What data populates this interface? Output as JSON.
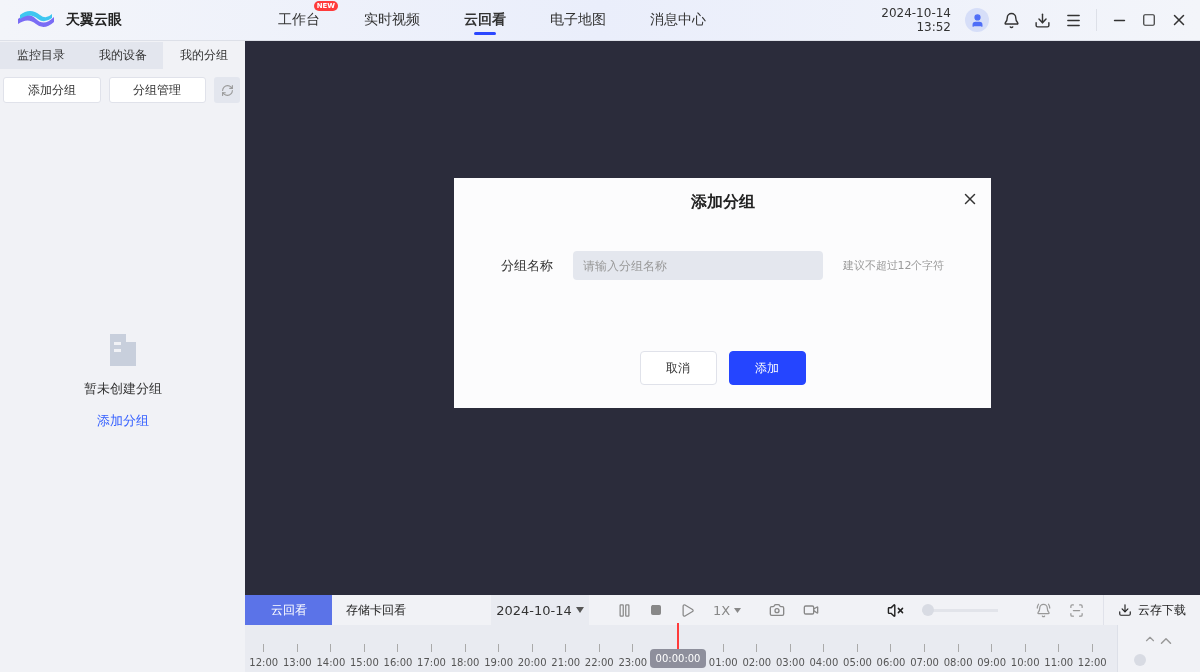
{
  "app": {
    "name": "天翼云眼"
  },
  "nav": [
    {
      "label": "工作台",
      "selected": false,
      "badge": "NEW"
    },
    {
      "label": "实时视频",
      "selected": false
    },
    {
      "label": "云回看",
      "selected": true
    },
    {
      "label": "电子地图",
      "selected": false
    },
    {
      "label": "消息中心",
      "selected": false
    }
  ],
  "clock": {
    "date": "2024-10-14",
    "time": "13:52"
  },
  "sidebar": {
    "tabs": [
      {
        "label": "监控目录",
        "selected": false
      },
      {
        "label": "我的设备",
        "selected": false
      },
      {
        "label": "我的分组",
        "selected": true
      }
    ],
    "buttons": [
      "添加分组",
      "分组管理"
    ],
    "empty": {
      "message": "暂未创建分组",
      "link": "添加分组"
    }
  },
  "dialog": {
    "title": "添加分组",
    "field": {
      "label": "分组名称",
      "placeholder": "请输入分组名称",
      "hint": "建议不超过12个字符"
    },
    "buttons": [
      {
        "label": "取消",
        "kind": "secondary"
      },
      {
        "label": "添加",
        "kind": "primary"
      }
    ]
  },
  "player": {
    "tabs": [
      {
        "label": "云回看",
        "selected": true
      },
      {
        "label": "存储卡回看",
        "selected": false
      }
    ],
    "date": "2024-10-14",
    "speed": "1X",
    "volume": {
      "muted": true,
      "level": 0
    },
    "download": "云存下载",
    "zoom": {
      "level": 0
    }
  },
  "timeline": {
    "current": "00:00:00",
    "labels": [
      "12:00",
      "13:00",
      "14:00",
      "15:00",
      "16:00",
      "17:00",
      "18:00",
      "19:00",
      "20:00",
      "21:00",
      "22:00",
      "23:00",
      "01:00",
      "02:00",
      "03:00",
      "04:00",
      "05:00",
      "06:00",
      "07:00",
      "08:00",
      "09:00",
      "10:00",
      "11:00",
      "12:00"
    ]
  }
}
